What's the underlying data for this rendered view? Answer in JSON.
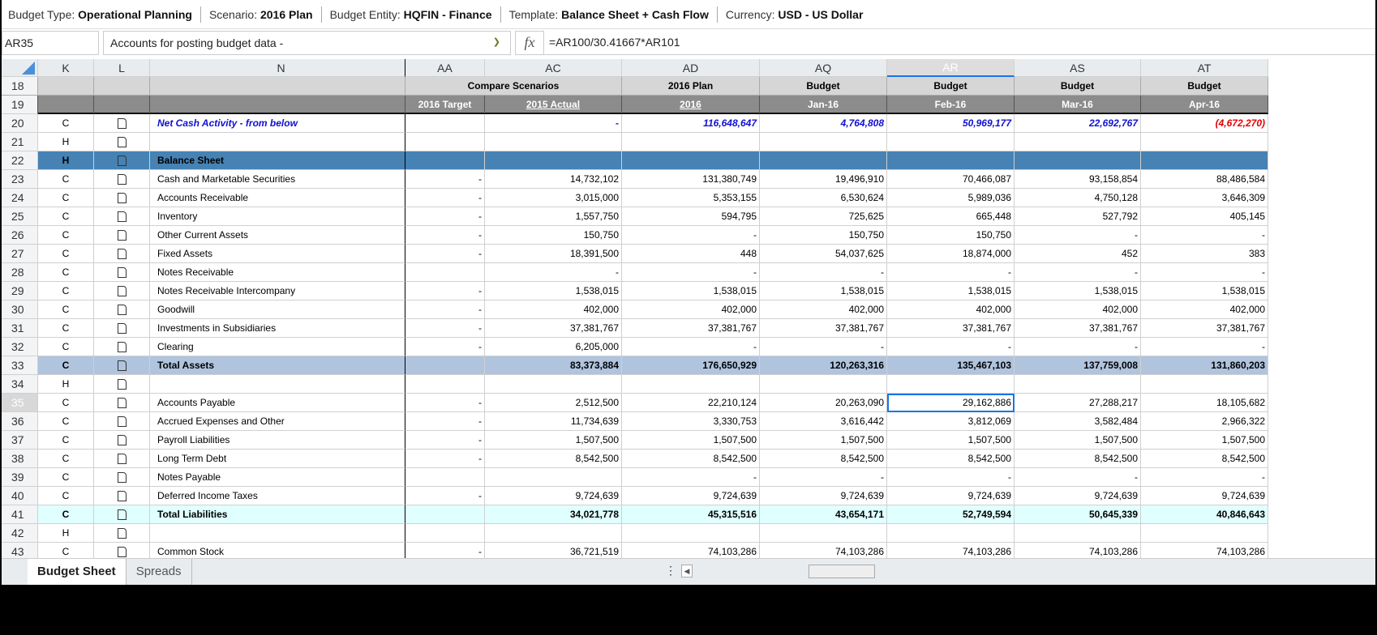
{
  "context_bar": [
    {
      "label": "Budget Type:",
      "value": "Operational Planning"
    },
    {
      "label": "Scenario:",
      "value": "2016 Plan"
    },
    {
      "label": "Budget Entity:",
      "value": "HQFIN - Finance"
    },
    {
      "label": "Template:",
      "value": "Balance Sheet + Cash Flow"
    },
    {
      "label": "Currency:",
      "value": "USD - US Dollar"
    }
  ],
  "formula_bar": {
    "cell_ref": "AR35",
    "account": "Accounts for posting budget data -",
    "fx": "fx",
    "formula": "=AR100/30.41667*AR101"
  },
  "columns": [
    "K",
    "L",
    "N",
    "AA",
    "AC",
    "AD",
    "AQ",
    "AR",
    "AS",
    "AT"
  ],
  "selected_column": "AR",
  "header_row18": {
    "row": "18",
    "compare": "Compare Scenarios",
    "ad": "2016 Plan",
    "aq": "Budget",
    "ar": "Budget",
    "as": "Budget",
    "at": "Budget"
  },
  "header_row19": {
    "row": "19",
    "aa": "2016 Target",
    "ac": "2015 Actual",
    "ad": "2016",
    "aq": "Jan-16",
    "ar": "Feb-16",
    "as": "Mar-16",
    "at": "Apr-16"
  },
  "rows": [
    {
      "row": "20",
      "k": "C",
      "n": "Net Cash Activity - from below",
      "style": "blue",
      "v": [
        "",
        "-",
        "116,648,647",
        "4,764,808",
        "50,969,177",
        "22,692,767",
        "(4,672,270)"
      ]
    },
    {
      "row": "21",
      "k": "H",
      "n": "",
      "v": [
        "",
        "",
        "",
        "",
        "",
        "",
        ""
      ]
    },
    {
      "row": "22",
      "k": "H",
      "n": "Balance Sheet",
      "style": "bs",
      "v": [
        "",
        "",
        "",
        "",
        "",
        "",
        ""
      ]
    },
    {
      "row": "23",
      "k": "C",
      "n": "Cash and Marketable Securities",
      "v": [
        "-",
        "14,732,102",
        "131,380,749",
        "19,496,910",
        "70,466,087",
        "93,158,854",
        "88,486,584"
      ]
    },
    {
      "row": "24",
      "k": "C",
      "n": "Accounts Receivable",
      "v": [
        "-",
        "3,015,000",
        "5,353,155",
        "6,530,624",
        "5,989,036",
        "4,750,128",
        "3,646,309"
      ]
    },
    {
      "row": "25",
      "k": "C",
      "n": "Inventory",
      "v": [
        "-",
        "1,557,750",
        "594,795",
        "725,625",
        "665,448",
        "527,792",
        "405,145"
      ]
    },
    {
      "row": "26",
      "k": "C",
      "n": "Other Current Assets",
      "v": [
        "-",
        "150,750",
        "-",
        "150,750",
        "150,750",
        "-",
        "-"
      ]
    },
    {
      "row": "27",
      "k": "C",
      "n": "Fixed Assets",
      "v": [
        "-",
        "18,391,500",
        "448",
        "54,037,625",
        "18,874,000",
        "452",
        "383"
      ]
    },
    {
      "row": "28",
      "k": "C",
      "n": "Notes Receivable",
      "v": [
        "",
        "-",
        "-",
        "-",
        "-",
        "-",
        "-"
      ]
    },
    {
      "row": "29",
      "k": "C",
      "n": "Notes Receivable Intercompany",
      "v": [
        "-",
        "1,538,015",
        "1,538,015",
        "1,538,015",
        "1,538,015",
        "1,538,015",
        "1,538,015"
      ]
    },
    {
      "row": "30",
      "k": "C",
      "n": "Goodwill",
      "v": [
        "-",
        "402,000",
        "402,000",
        "402,000",
        "402,000",
        "402,000",
        "402,000"
      ]
    },
    {
      "row": "31",
      "k": "C",
      "n": "Investments in Subsidiaries",
      "v": [
        "-",
        "37,381,767",
        "37,381,767",
        "37,381,767",
        "37,381,767",
        "37,381,767",
        "37,381,767"
      ]
    },
    {
      "row": "32",
      "k": "C",
      "n": "Clearing",
      "v": [
        "-",
        "6,205,000",
        "-",
        "-",
        "-",
        "-",
        "-"
      ]
    },
    {
      "row": "33",
      "k": "C",
      "n": "Total Assets",
      "style": "ta",
      "v": [
        "",
        "83,373,884",
        "176,650,929",
        "120,263,316",
        "135,467,103",
        "137,759,008",
        "131,860,203"
      ]
    },
    {
      "row": "34",
      "k": "H",
      "n": "",
      "v": [
        "",
        "",
        "",
        "",
        "",
        "",
        ""
      ]
    },
    {
      "row": "35",
      "k": "C",
      "n": "Accounts Payable",
      "selected": true,
      "v": [
        "-",
        "2,512,500",
        "22,210,124",
        "20,263,090",
        "29,162,886",
        "27,288,217",
        "18,105,682"
      ]
    },
    {
      "row": "36",
      "k": "C",
      "n": "Accrued Expenses and Other",
      "v": [
        "-",
        "11,734,639",
        "3,330,753",
        "3,616,442",
        "3,812,069",
        "3,582,484",
        "2,966,322"
      ]
    },
    {
      "row": "37",
      "k": "C",
      "n": "Payroll Liabilities",
      "v": [
        "-",
        "1,507,500",
        "1,507,500",
        "1,507,500",
        "1,507,500",
        "1,507,500",
        "1,507,500"
      ]
    },
    {
      "row": "38",
      "k": "C",
      "n": "Long Term Debt",
      "v": [
        "-",
        "8,542,500",
        "8,542,500",
        "8,542,500",
        "8,542,500",
        "8,542,500",
        "8,542,500"
      ]
    },
    {
      "row": "39",
      "k": "C",
      "n": "Notes Payable",
      "v": [
        "",
        "",
        "-",
        "-",
        "-",
        "-",
        "-"
      ]
    },
    {
      "row": "40",
      "k": "C",
      "n": "Deferred Income Taxes",
      "v": [
        "-",
        "9,724,639",
        "9,724,639",
        "9,724,639",
        "9,724,639",
        "9,724,639",
        "9,724,639"
      ]
    },
    {
      "row": "41",
      "k": "C",
      "n": "Total Liabilities",
      "style": "tl",
      "v": [
        "",
        "34,021,778",
        "45,315,516",
        "43,654,171",
        "52,749,594",
        "50,645,339",
        "40,846,643"
      ]
    },
    {
      "row": "42",
      "k": "H",
      "n": "",
      "v": [
        "",
        "",
        "",
        "",
        "",
        "",
        ""
      ]
    },
    {
      "row": "43",
      "k": "C",
      "n": "Common Stock",
      "v": [
        "-",
        "36,721,519",
        "74,103,286",
        "74,103,286",
        "74,103,286",
        "74,103,286",
        "74,103,286"
      ]
    }
  ],
  "sheet_tabs": [
    {
      "label": "Budget Sheet",
      "active": true
    },
    {
      "label": "Spreads"
    }
  ],
  "colors": {
    "blue_text": "#1010d0",
    "negative": "#e00000",
    "balance_sheet": "#4682b4",
    "total_assets": "#b0c4de",
    "total_liabilities": "#e0ffff",
    "selection": "#1a73e8"
  }
}
